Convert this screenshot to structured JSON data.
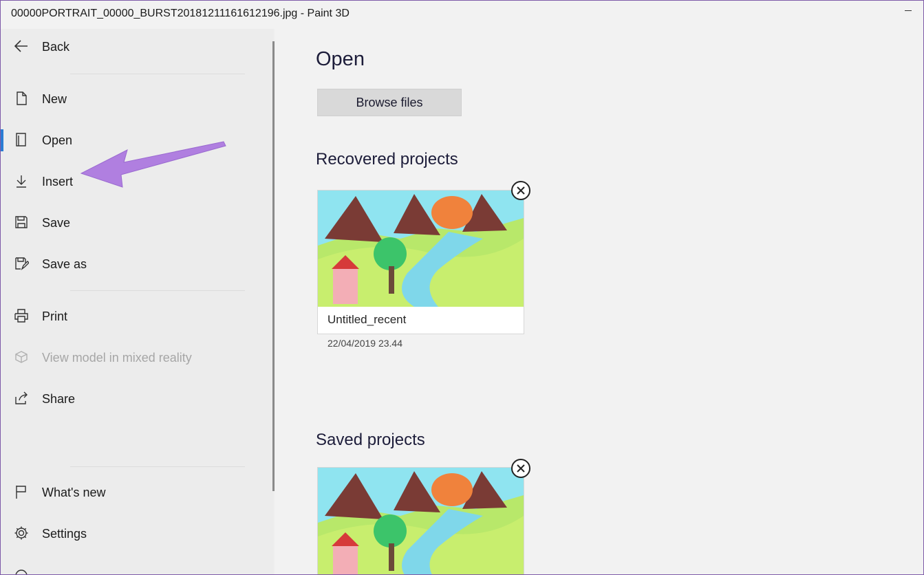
{
  "window": {
    "title": "00000PORTRAIT_00000_BURST20181211161612196.jpg - Paint 3D"
  },
  "sidebar": {
    "back": {
      "label": "Back",
      "icon": "back-arrow-icon"
    },
    "items": [
      {
        "key": "new",
        "label": "New",
        "icon": "new-file-icon",
        "active": false,
        "disabled": false
      },
      {
        "key": "open",
        "label": "Open",
        "icon": "open-file-icon",
        "active": true,
        "disabled": false
      },
      {
        "key": "insert",
        "label": "Insert",
        "icon": "insert-download-icon",
        "active": false,
        "disabled": false
      },
      {
        "key": "save",
        "label": "Save",
        "icon": "save-floppy-icon",
        "active": false,
        "disabled": false
      },
      {
        "key": "save_as",
        "label": "Save as",
        "icon": "save-as-icon",
        "active": false,
        "disabled": false
      },
      {
        "key": "print",
        "label": "Print",
        "icon": "printer-icon",
        "active": false,
        "disabled": false
      },
      {
        "key": "mixed_reality",
        "label": "View model in mixed reality",
        "icon": "mixed-reality-icon",
        "active": false,
        "disabled": true
      },
      {
        "key": "share",
        "label": "Share",
        "icon": "share-icon",
        "active": false,
        "disabled": false
      },
      {
        "key": "whats_new",
        "label": "What's new",
        "icon": "flag-icon",
        "active": false,
        "disabled": false
      },
      {
        "key": "settings",
        "label": "Settings",
        "icon": "gear-icon",
        "active": false,
        "disabled": false
      }
    ],
    "accent_color": "#2b7cd3"
  },
  "main": {
    "title": "Open",
    "browse_button": "Browse files",
    "recovered": {
      "title": "Recovered projects",
      "card": {
        "name": "Untitled_recent",
        "date": "22/04/2019 23.44"
      }
    },
    "saved": {
      "title": "Saved projects"
    }
  },
  "annotation": {
    "type": "arrow",
    "color": "#b07fe0",
    "points_to": "Insert"
  }
}
